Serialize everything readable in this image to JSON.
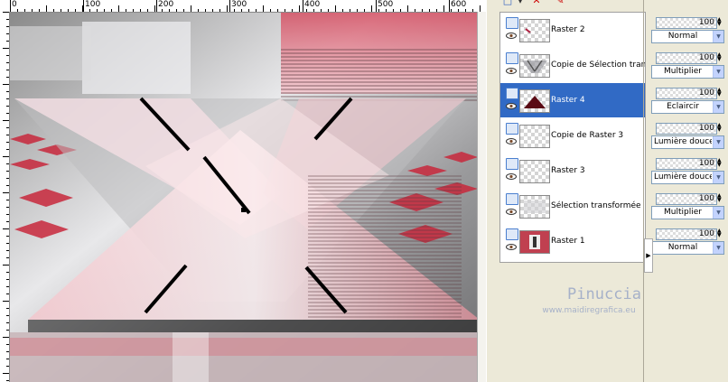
{
  "ruler": {
    "labels": [
      "0",
      "100",
      "200",
      "300",
      "400",
      "500",
      "600"
    ]
  },
  "layers": [
    {
      "name": "Raster 2",
      "selected": false,
      "opacity": "100",
      "blend": "Normal"
    },
    {
      "name": "Copie de Sélection transf",
      "selected": false,
      "opacity": "100",
      "blend": "Multiplier"
    },
    {
      "name": "Raster 4",
      "selected": true,
      "opacity": "100",
      "blend": "Eclaircir"
    },
    {
      "name": "Copie de Raster 3",
      "selected": false,
      "opacity": "100",
      "blend": "Lumière douce"
    },
    {
      "name": "Raster 3",
      "selected": false,
      "opacity": "100",
      "blend": "Lumière douce"
    },
    {
      "name": "Sélection transformée",
      "selected": false,
      "opacity": "100",
      "blend": "Multiplier"
    },
    {
      "name": "Raster 1",
      "selected": false,
      "opacity": "100",
      "blend": "Normal"
    }
  ],
  "watermark": {
    "title": "Pinuccia",
    "url": "www.maidiregrafica.eu"
  },
  "icons": {
    "toolbar": [
      "new-layer-icon",
      "delete-layer-icon",
      "edit-layer-icon"
    ],
    "layer_visibility": "eye-icon"
  },
  "colors": {
    "selection": "#316ac5",
    "accent_red": "#c8283c",
    "watermark": "#a6b1c9"
  }
}
